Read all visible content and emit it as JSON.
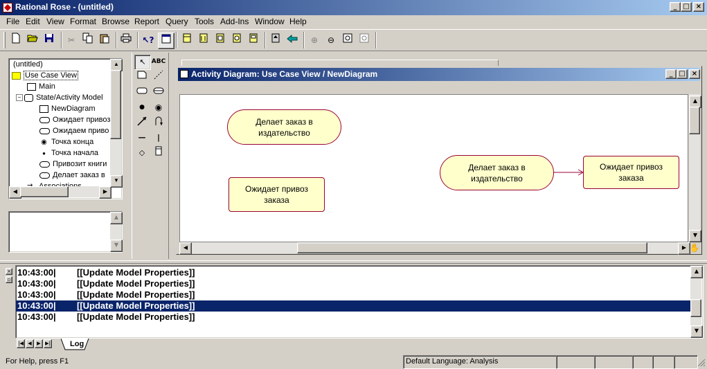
{
  "app": {
    "title": "Rational Rose - (untitled)"
  },
  "menu": [
    "File",
    "Edit",
    "View",
    "Format",
    "Browse",
    "Report",
    "Query",
    "Tools",
    "Add-Ins",
    "Window",
    "Help"
  ],
  "toolbar_icons": [
    "new-icon",
    "open-icon",
    "save-icon",
    "cut-icon",
    "copy-icon",
    "paste-icon",
    "print-icon",
    "context-help-icon",
    "view-doc-icon",
    "browse-class-icon",
    "browse-interaction-icon",
    "browse-component-icon",
    "browse-deployment-icon",
    "browse-parent-icon",
    "browse-previous-icon",
    "zoom-in-icon",
    "zoom-out-icon",
    "fit-window-icon",
    "undo-fit-icon"
  ],
  "browser": {
    "root": "(untitled)",
    "items": [
      {
        "label": "Use Case View",
        "icon": "folder-icon",
        "selected": true
      },
      {
        "label": "Main",
        "icon": "use-case-diagram-icon"
      },
      {
        "label": "State/Activity Model",
        "icon": "state-model-icon"
      },
      {
        "label": "NewDiagram",
        "icon": "activity-diagram-icon"
      },
      {
        "label": "Ожидает привоз",
        "icon": "state-icon"
      },
      {
        "label": "Ожидаем приво",
        "icon": "state-icon"
      },
      {
        "label": "Точка конца",
        "icon": "end-state-icon"
      },
      {
        "label": "Точка начала",
        "icon": "start-state-icon"
      },
      {
        "label": "Привозит книги",
        "icon": "activity-icon"
      },
      {
        "label": "Делает заказ в",
        "icon": "activity-icon"
      },
      {
        "label": "Associations",
        "icon": "association-icon"
      }
    ]
  },
  "diagram_window": {
    "title": "Activity Diagram: Use Case View / NewDiagram",
    "shapes": {
      "activity1": "Делает заказ в\nиздательство",
      "state1": "Ожидает привоз\nзаказа",
      "activity2": "Делает заказ в\nиздательство",
      "state2": "Ожидает привоз\nзаказа"
    }
  },
  "log": {
    "rows": [
      {
        "time": "10:43:00|",
        "text": "[[Update Model Properties]]",
        "selected": false
      },
      {
        "time": "10:43:00|",
        "text": "[[Update Model Properties]]",
        "selected": false
      },
      {
        "time": "10:43:00|",
        "text": "[[Update Model Properties]]",
        "selected": false
      },
      {
        "time": "10:43:00|",
        "text": "[[Update Model Properties]]",
        "selected": true
      },
      {
        "time": "10:43:00|",
        "text": "[[Update Model Properties]]",
        "selected": false
      }
    ],
    "tab_label": "Log"
  },
  "status": {
    "help": "For Help, press F1",
    "language": "Default Language: Analysis"
  },
  "colors": {
    "title_start": "#0a246a",
    "title_end": "#a6caf0",
    "selection": "#0a246a",
    "note_fill": "#ffffcc",
    "note_border": "#990033"
  }
}
